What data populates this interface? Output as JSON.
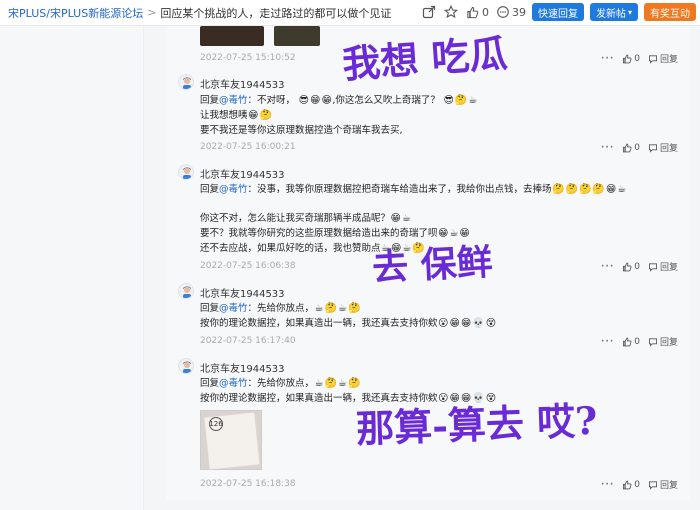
{
  "header": {
    "breadcrumb_forum": "宋PLUS/宋PLUS新能源论坛",
    "breadcrumb_sep": ">",
    "thread_title": "回应某个挑战的人，走过路过的都可以做个见证",
    "like_count": "0",
    "comment_count": "39",
    "quick_reply_label": "快速回复",
    "new_post_label": "发新帖",
    "new_post_caret": "▾",
    "reward_label": "有奖互动"
  },
  "top_timestamp": "2022-07-25 15:10:52",
  "actions": {
    "more": "···",
    "like_count": "0",
    "reply_label": "回复"
  },
  "comments": [
    {
      "user": "北京车友1944533",
      "lines": [
        {
          "prefix": "回复",
          "mention": "@毒竹",
          "text": "：不对呀，",
          "emoji": [
            "😎",
            "😁",
            "😁"
          ],
          "text2": ",你这怎么又吹上奇瑞了？",
          "emoji2": [
            "😎",
            "🤔",
            "☕"
          ]
        },
        {
          "text": "让我想想咦",
          "emoji": [
            "😁",
            "🤔"
          ]
        },
        {
          "text": "要不我还是等你这原理数据控造个奇瑞车我去买,"
        }
      ],
      "time": "2022-07-25 16:00:21"
    },
    {
      "user": "北京车友1944533",
      "lines": [
        {
          "prefix": "回复",
          "mention": "@毒竹",
          "text": "：没事，我等你原理数据控把奇瑞车给造出来了，我给你出点钱，去捧场",
          "emoji": [
            "🤔",
            "🤔",
            "🤔",
            "🤔",
            "😁",
            "☕"
          ]
        },
        {
          "text": ""
        },
        {
          "text": "你这不对，怎么能让我买奇瑞那辆半成品呢？",
          "emoji": [
            "😁",
            "☕"
          ]
        },
        {
          "text": "要不？我就等你研究的这些原理数据给造出来的奇瑞了呗",
          "emoji": [
            "😁",
            "☕",
            "😁"
          ]
        },
        {
          "text": "还不去应战，如果瓜好吃的话，我也赞助点",
          "emoji": [
            "☕",
            "😁",
            "☕",
            "🤔"
          ]
        }
      ],
      "time": "2022-07-25 16:06:38"
    },
    {
      "user": "北京车友1944533",
      "lines": [
        {
          "prefix": "回复",
          "mention": "@毒竹",
          "text": "：先给你放点，",
          "emoji": [
            "☕",
            "🤔",
            "☕",
            "🤔"
          ]
        },
        {
          "text": "按你的理论数据控，如果真造出一辆，我还真去支持你欸",
          "emoji": [
            "😮",
            "😁",
            "😁",
            "💀",
            "😵"
          ]
        }
      ],
      "time": "2022-07-25 16:17:40"
    },
    {
      "user": "北京车友1944533",
      "lines": [
        {
          "prefix": "回复",
          "mention": "@毒竹",
          "text": "：先给你放点，",
          "emoji": [
            "☕",
            "🤔",
            "☕",
            "🤔"
          ]
        },
        {
          "text": "按你的理论数据控，如果真造出一辆，我还真去支持你欸",
          "emoji": [
            "😮",
            "😁",
            "😁",
            "💀",
            "😵"
          ]
        }
      ],
      "picture_number": "126",
      "time": "2022-07-25 16:18:38"
    }
  ],
  "handwriting": {
    "note1": "我想 吃瓜",
    "note2": "去 保鲜",
    "note3": "那算-算去 哎?"
  },
  "colors": {
    "link": "#2266cc",
    "handwriting": "#6a2bd6",
    "accent_blue": "#1f7ae0",
    "accent_orange": "#f0781e"
  }
}
